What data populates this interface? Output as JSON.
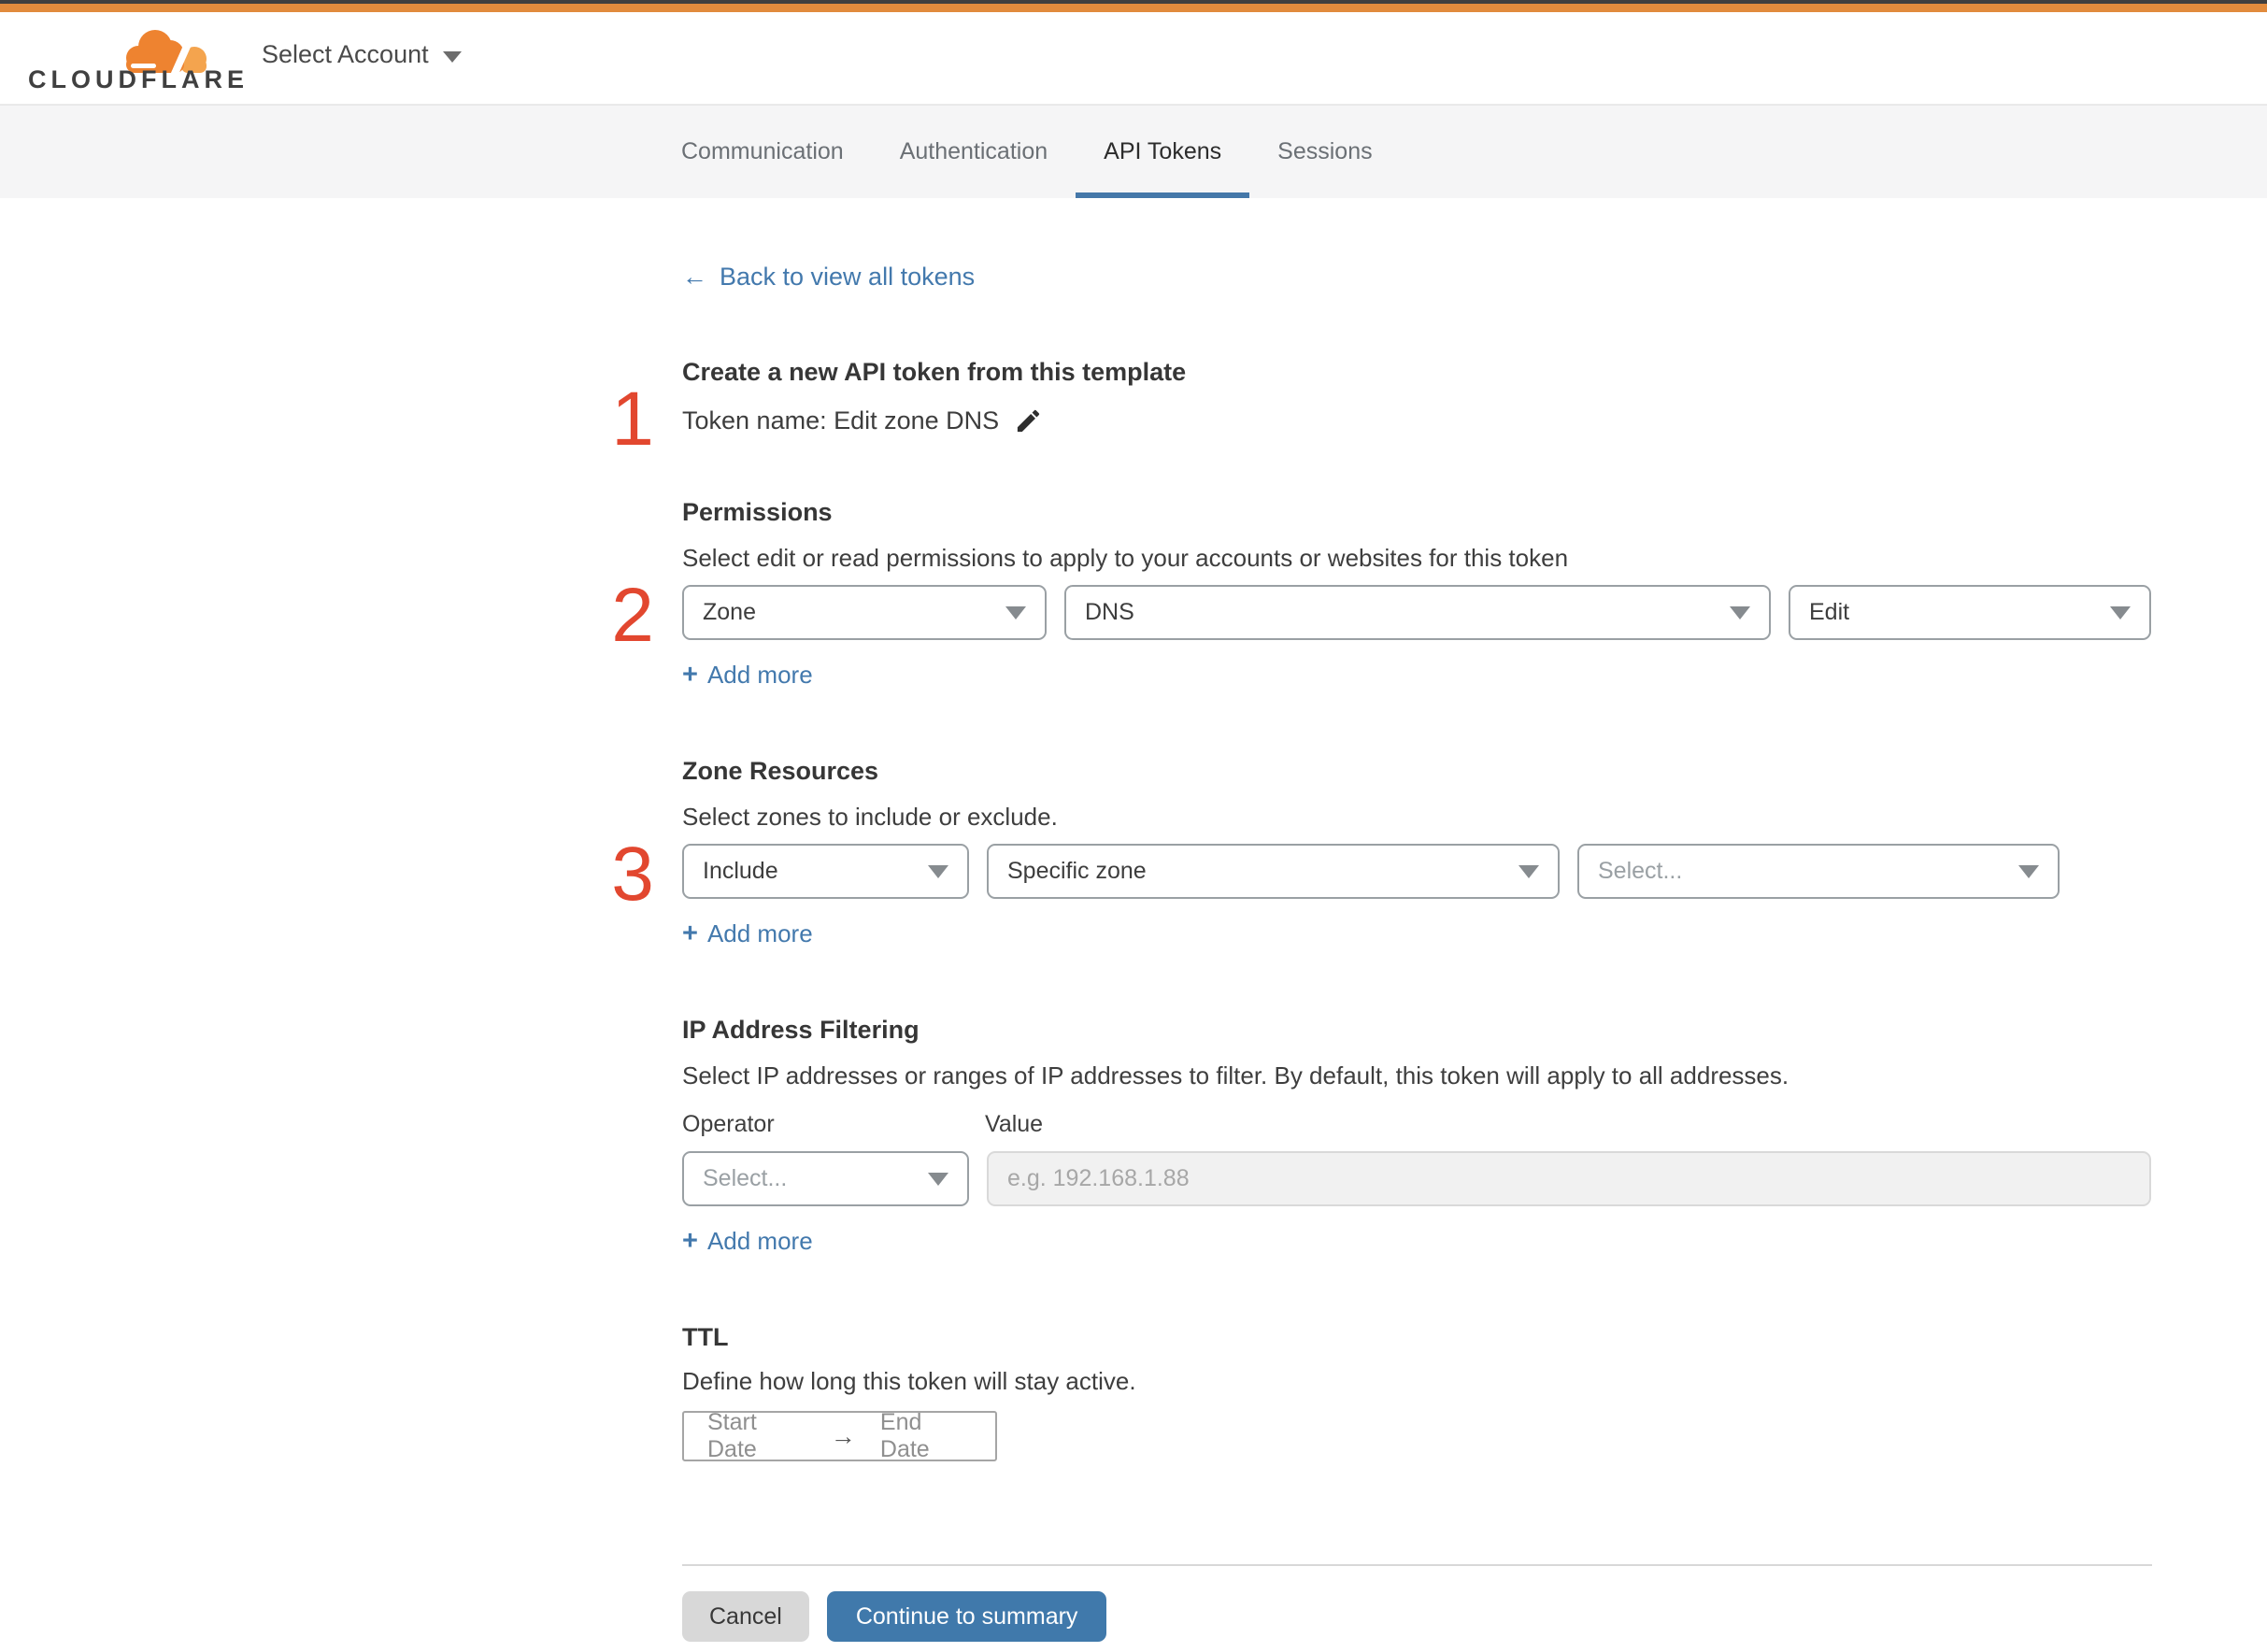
{
  "theme": {
    "brand_orange": "#e18b3d",
    "top_edge": "#3f3f3f",
    "link_blue": "#4379ad",
    "button_blue": "#4079ab",
    "tab_underline": "#4578a9",
    "annotation_red": "#e2472f"
  },
  "header": {
    "logo_text": "CLOUDFLARE",
    "account_selector": "Select Account"
  },
  "nav": {
    "tabs": [
      {
        "label": "Communication",
        "active": false
      },
      {
        "label": "Authentication",
        "active": false
      },
      {
        "label": "API Tokens",
        "active": true
      },
      {
        "label": "Sessions",
        "active": false
      }
    ]
  },
  "annotations": {
    "step1": "1",
    "step2": "2",
    "step3": "3"
  },
  "content": {
    "back_arrow": "←",
    "back_link": "Back to view all tokens",
    "template_heading": "Create a new API token from this template",
    "token_line": "Token name: Edit zone DNS",
    "permissions": {
      "title": "Permissions",
      "description": "Select edit or read permissions to apply to your accounts or websites for this token",
      "scope_value": "Zone",
      "resource_value": "DNS",
      "access_value": "Edit",
      "add_more_plus": "+",
      "add_more": "Add more"
    },
    "zone_resources": {
      "title": "Zone Resources",
      "description": "Select zones to include or exclude.",
      "mode_value": "Include",
      "type_value": "Specific zone",
      "zone_placeholder": "Select...",
      "add_more_plus": "+",
      "add_more": "Add more"
    },
    "ip_filtering": {
      "title": "IP Address Filtering",
      "description": "Select IP addresses or ranges of IP addresses to filter. By default, this token will apply to all addresses.",
      "operator_label": "Operator",
      "value_label": "Value",
      "operator_placeholder": "Select...",
      "value_placeholder": "e.g. 192.168.1.88",
      "add_more_plus": "+",
      "add_more": "Add more"
    },
    "ttl": {
      "title": "TTL",
      "description": "Define how long this token will stay active.",
      "start_placeholder": "Start Date",
      "arrow": "→",
      "end_placeholder": "End Date"
    },
    "footer": {
      "cancel": "Cancel",
      "continue": "Continue to summary"
    }
  }
}
